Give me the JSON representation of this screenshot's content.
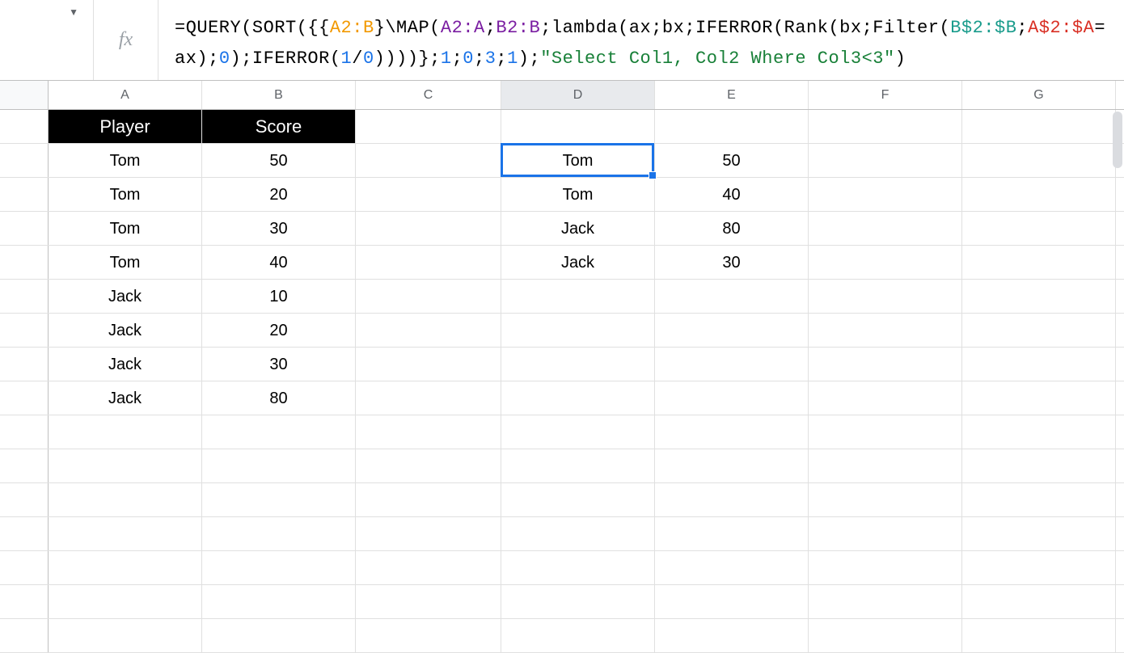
{
  "formula": {
    "tokens": [
      {
        "t": "=QUERY(SORT({{",
        "c": "black"
      },
      {
        "t": "A2:B",
        "c": "orange"
      },
      {
        "t": "}\\MAP(",
        "c": "black"
      },
      {
        "t": "A2:A",
        "c": "purple"
      },
      {
        "t": ";",
        "c": "black"
      },
      {
        "t": "B2:B",
        "c": "purple"
      },
      {
        "t": ";lambda(ax;bx;IFERROR(Rank(bx;Filter(",
        "c": "black"
      },
      {
        "t": "B$2:$B",
        "c": "teal"
      },
      {
        "t": ";",
        "c": "black"
      },
      {
        "t": "A$2:$A",
        "c": "red"
      },
      {
        "t": "=ax);",
        "c": "black"
      },
      {
        "t": "0",
        "c": "blue"
      },
      {
        "t": ");IFERROR(",
        "c": "black"
      },
      {
        "t": "1",
        "c": "blue"
      },
      {
        "t": "/",
        "c": "black"
      },
      {
        "t": "0",
        "c": "blue"
      },
      {
        "t": "))))};",
        "c": "black"
      },
      {
        "t": "1",
        "c": "blue"
      },
      {
        "t": ";",
        "c": "black"
      },
      {
        "t": "0",
        "c": "blue"
      },
      {
        "t": ";",
        "c": "black"
      },
      {
        "t": "3",
        "c": "blue"
      },
      {
        "t": ";",
        "c": "black"
      },
      {
        "t": "1",
        "c": "blue"
      },
      {
        "t": ");",
        "c": "black"
      },
      {
        "t": "\"Select Col1, Col2 Where Col3<3\"",
        "c": "green"
      },
      {
        "t": ")",
        "c": "black"
      }
    ]
  },
  "columns": [
    "A",
    "B",
    "C",
    "D",
    "E",
    "F",
    "G"
  ],
  "active_column": "D",
  "selected_cell": {
    "col": "D",
    "row": 2
  },
  "header_row": {
    "A": "Player",
    "B": "Score"
  },
  "data_rows": [
    {
      "A": "Tom",
      "B": "50",
      "D": "Tom",
      "E": "50"
    },
    {
      "A": "Tom",
      "B": "20",
      "D": "Tom",
      "E": "40"
    },
    {
      "A": "Tom",
      "B": "30",
      "D": "Jack",
      "E": "80"
    },
    {
      "A": "Tom",
      "B": "40",
      "D": "Jack",
      "E": "30"
    },
    {
      "A": "Jack",
      "B": "10"
    },
    {
      "A": "Jack",
      "B": "20"
    },
    {
      "A": "Jack",
      "B": "30"
    },
    {
      "A": "Jack",
      "B": "80"
    },
    {},
    {},
    {},
    {},
    {},
    {},
    {}
  ],
  "fx_label": "fx",
  "namebox_glyph": "▼"
}
